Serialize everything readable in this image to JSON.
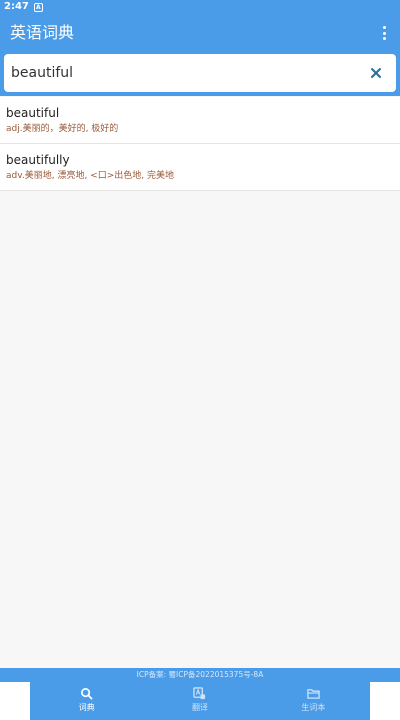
{
  "status_bar": {
    "time": "2:47",
    "notification_glyph": "A"
  },
  "app_bar": {
    "title": "英语词典",
    "menu_icon": "more-vertical-icon"
  },
  "search": {
    "value": "beautiful",
    "clear_icon": "close-icon"
  },
  "results": [
    {
      "word": "beautiful",
      "definition": "adj.美丽的，美好的, 极好的"
    },
    {
      "word": "beautifully",
      "definition": "adv.美丽地, 漂亮地, <口>出色地, 完美地"
    }
  ],
  "footer": {
    "icp_text": "ICP备案: 蜀ICP备2022015375号-8A"
  },
  "bottom_nav": {
    "items": [
      {
        "label": "词典",
        "icon": "search-icon",
        "active": true
      },
      {
        "label": "翻译",
        "icon": "translate-icon",
        "active": false
      },
      {
        "label": "生词本",
        "icon": "folder-icon",
        "active": false
      }
    ]
  },
  "colors": {
    "primary": "#4a9be8",
    "definition_text": "#9a5a3a",
    "clear_icon": "#2a6e9a"
  }
}
